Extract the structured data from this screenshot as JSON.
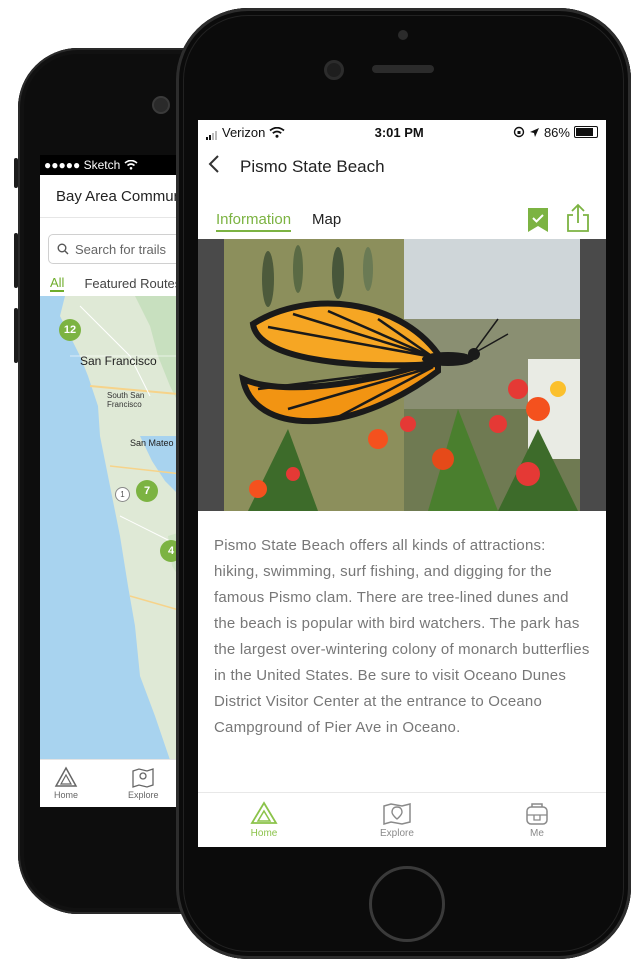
{
  "back_phone": {
    "status": {
      "carrier": "●●●●● Sketch"
    },
    "title": "Bay Area Communit",
    "search_placeholder": "Search for trails",
    "tabs": [
      {
        "label": "All",
        "active": true
      },
      {
        "label": "Featured Routes",
        "active": false
      }
    ],
    "map": {
      "labels": [
        "San Francisco",
        "South San",
        "Francisco",
        "San Mateo"
      ],
      "clusters": [
        "12",
        "7",
        "4",
        "1"
      ]
    },
    "tabbar": [
      {
        "label": "Home",
        "icon": "home-triangle-icon"
      },
      {
        "label": "Explore",
        "icon": "map-pin-icon"
      }
    ]
  },
  "front_phone": {
    "status": {
      "carrier": "Verizon",
      "time": "3:01 PM",
      "battery": "86%"
    },
    "nav_title": "Pismo State Beach",
    "tabs": [
      {
        "label": "Information",
        "active": true
      },
      {
        "label": "Map",
        "active": false
      }
    ],
    "accent_color": "#7cb342",
    "description": "Pismo State Beach offers all kinds of attractions: hiking, swimming, surf fishing, and digging for the famous Pismo clam. There are tree-lined dunes and the beach is popular with bird watchers. The park has the largest over-wintering colony of monarch butterflies in the United States. Be sure to visit Oceano Dunes District Visitor Center at the entrance to Oceano Campground of Pier Ave in Oceano.",
    "tabbar": [
      {
        "label": "Home",
        "icon": "home-triangle-icon",
        "active": true
      },
      {
        "label": "Explore",
        "icon": "map-pin-icon",
        "active": false
      },
      {
        "label": "Me",
        "icon": "backpack-icon",
        "active": false
      }
    ]
  }
}
